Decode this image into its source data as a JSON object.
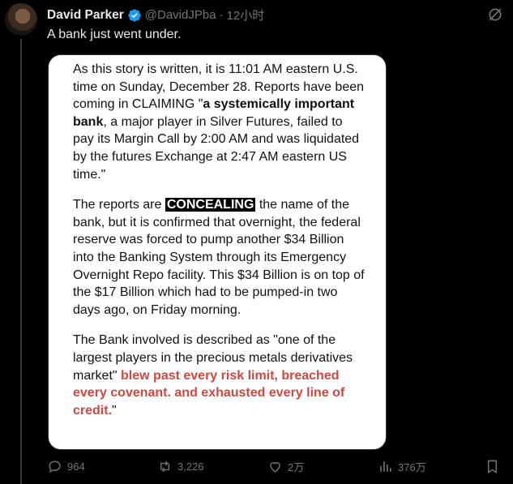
{
  "author": {
    "name": "David Parker",
    "handle": "@DavidJPba",
    "separator": "·",
    "time": "12小时"
  },
  "tweet": {
    "text": "A bank just went under."
  },
  "document": {
    "p1_a": "As this story is written, it is 11:01 AM eastern U.S. time on Sunday, December 28.  Reports have been coming in CLAIMING \"",
    "p1_bold": "a systemically important bank",
    "p1_b": ", a major player in Silver Futures, failed to pay its Margin Call by 2:00 AM and was liquidated by the futures Exchange at 2:47 AM eastern US time.\"",
    "p2_a": "The reports are ",
    "p2_highlight": "CONCEALING",
    "p2_b": " the name of the bank, but it is confirmed that overnight, the federal reserve was forced to pump another $34 Billion into the Banking System through its Emergency Overnight Repo facility.   This $34 Billion is on top of the $17 Billion which had to be pumped-in two days ago, on Friday morning.",
    "p3_a": "The Bank involved is described as \"one of the largest players in the precious metals derivatives market\" ",
    "p3_red": "blew past every risk limit, breached every covenant. and exhausted every line of credit.",
    "p3_b": "\""
  },
  "actions": {
    "replies": "964",
    "reposts": "3,226",
    "likes": "2万",
    "views": "376万"
  },
  "colors": {
    "accent": "#1d9bf0",
    "muted": "#71767b",
    "red_text": "#cf4740"
  }
}
